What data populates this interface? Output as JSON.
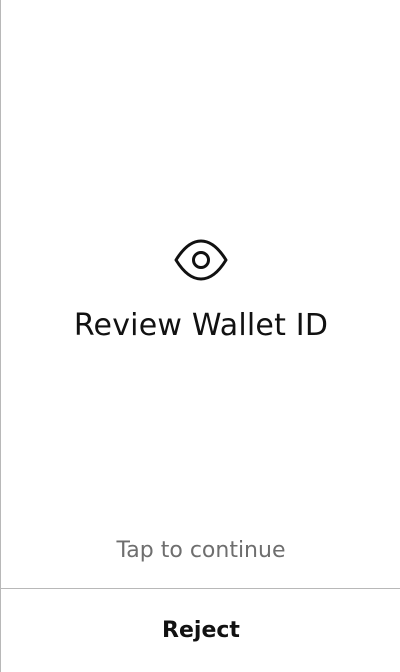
{
  "screen": {
    "icon": "eye-icon",
    "title": "Review Wallet ID",
    "hint": "Tap to continue"
  },
  "footer": {
    "reject_label": "Reject"
  },
  "colors": {
    "text_primary": "#111111",
    "text_secondary": "#6e6e6e",
    "divider": "#b8b8b8",
    "background": "#ffffff"
  }
}
